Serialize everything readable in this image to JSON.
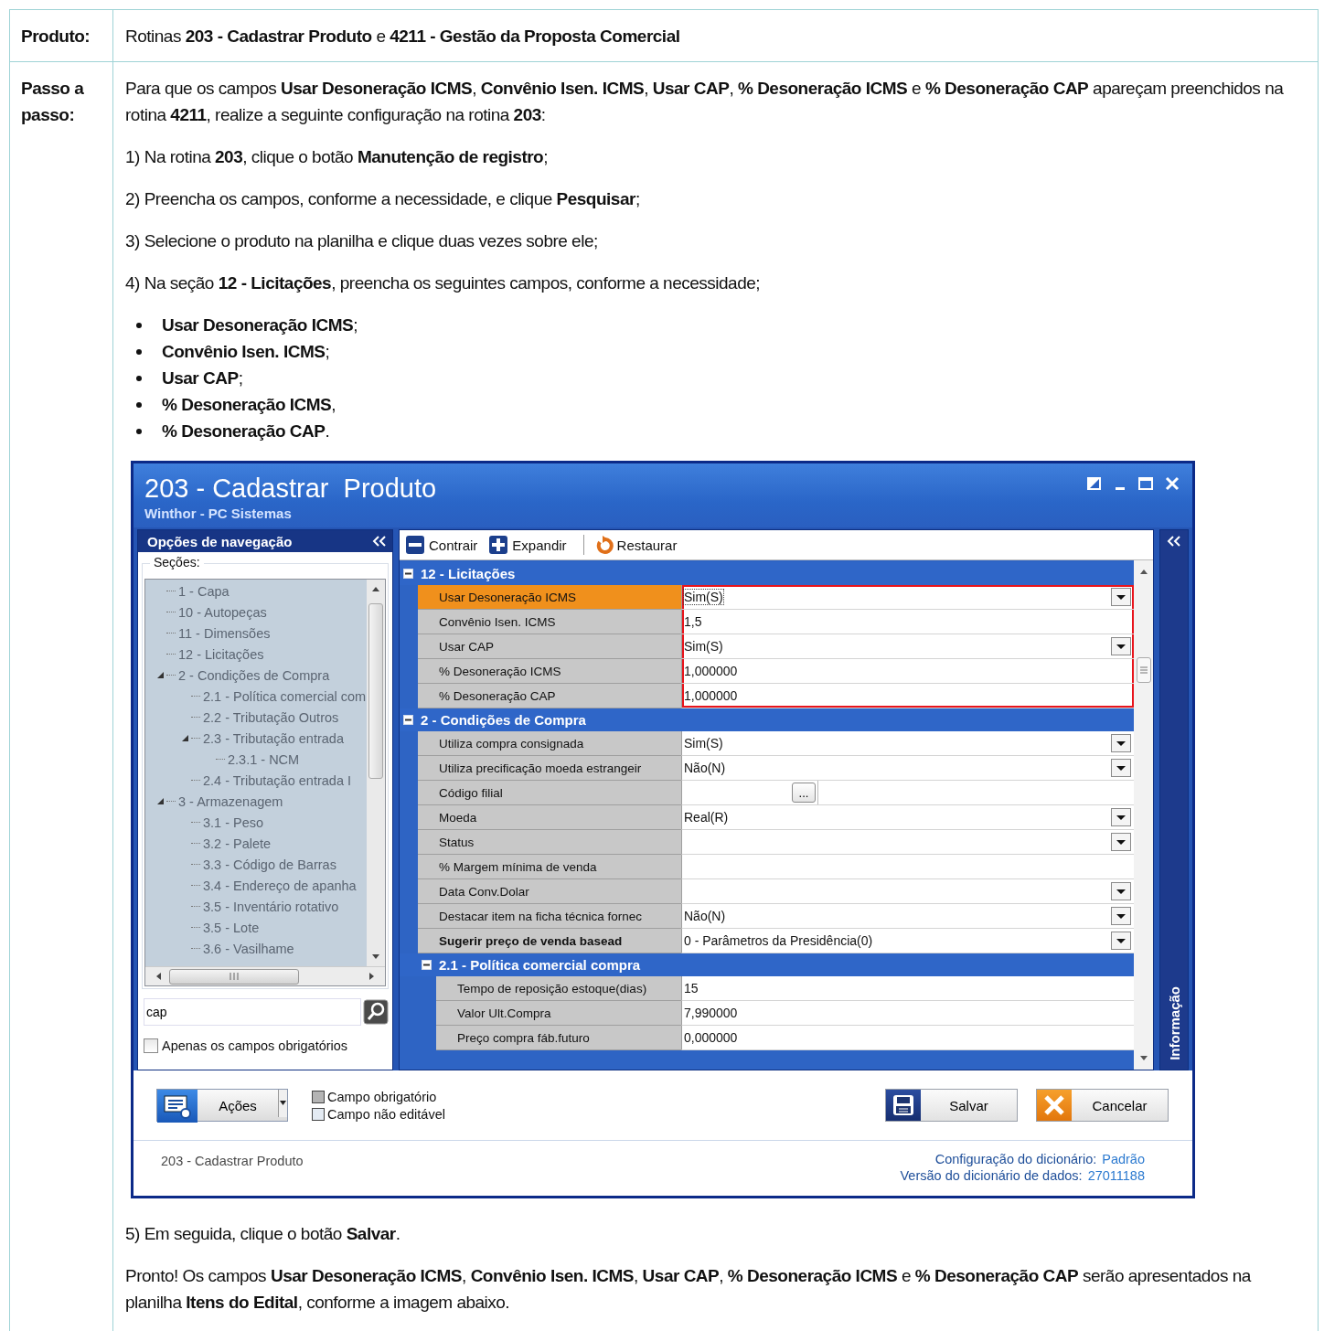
{
  "document": {
    "product_label": "Produto:",
    "product": "Rotinas **203 - Cadastrar Produto** e **4211 - Gestão da Proposta Comercial**",
    "steps_label": "Passo a passo:",
    "intro": "Para que os campos **Usar Desoneração ICMS**, **Convênio Isen. ICMS**, **Usar CAP**, **% Desoneração ICMS** e **% Desoneração CAP** apareçam preenchidos na rotina **4211**, realize a seguinte configuração na rotina **203**:",
    "steps": [
      "1) Na rotina **203**, clique o botão **Manutenção de registro**;",
      "2) Preencha os campos, conforme a necessidade, e clique **Pesquisar**;",
      "3) Selecione o produto na planilha e clique duas vezes sobre ele;",
      "4) Na seção **12 - Licitações**, preencha os seguintes campos, conforme a necessidade;"
    ],
    "bullets": [
      "**Usar Desoneração ICMS**;",
      "**Convênio Isen. ICMS**;",
      "**Usar CAP**;",
      "**% Desoneração ICMS**,",
      "**% Desoneração CAP**."
    ],
    "after": [
      "5) Em seguida, clique o botão **Salvar**.",
      "Pronto! Os campos **Usar Desoneração ICMS**, **Convênio Isen. ICMS**, **Usar CAP**, **% Desoneração ICMS** e **% Desoneração CAP** serão apresentados na planilha **Itens do Edital**, conforme a imagem abaixo."
    ]
  },
  "app": {
    "title": "203 - Cadastrar  Produto",
    "subtitle": "Winthor - PC Sistemas",
    "nav": {
      "title": "Opções de navegação",
      "sections_label": "Seções:",
      "tree": [
        {
          "label": "1 - Capa"
        },
        {
          "label": "10 - Autopeças"
        },
        {
          "label": "11 - Dimensões"
        },
        {
          "label": "12 - Licitações"
        },
        {
          "label": "2 - Condições de Compra",
          "expanded": true,
          "children": [
            {
              "label": "2.1 - Política comercial com"
            },
            {
              "label": "2.2 - Tributação Outros"
            },
            {
              "label": "2.3 - Tributação entrada",
              "expanded": true,
              "children": [
                {
                  "label": "2.3.1 - NCM"
                }
              ]
            },
            {
              "label": "2.4 - Tributação entrada I"
            }
          ]
        },
        {
          "label": "3 - Armazenagem",
          "expanded": true,
          "children": [
            {
              "label": "3.1 - Peso"
            },
            {
              "label": "3.2 - Palete"
            },
            {
              "label": "3.3 - Código de Barras"
            },
            {
              "label": "3.4 - Endereço de apanha"
            },
            {
              "label": "3.5 - Inventário rotativo"
            },
            {
              "label": "3.5 - Lote"
            },
            {
              "label": "3.6 - Vasilhame"
            }
          ]
        }
      ],
      "search": {
        "value": "cap"
      },
      "required_only": {
        "label": "Apenas os campos obrigatórios",
        "checked": false
      }
    },
    "toolbar": [
      {
        "label": "Contrair",
        "kind": "collapse"
      },
      {
        "label": "Expandir",
        "kind": "expand"
      },
      {
        "label": "Restaurar",
        "kind": "restore"
      }
    ],
    "grid": {
      "sections": [
        {
          "title": "12 - Licitações",
          "expanded": true,
          "rows": [
            {
              "label": "Usar Desoneração ICMS",
              "value": "Sim(S)",
              "kind": "combo",
              "selected": true,
              "outlined": true,
              "required": false
            },
            {
              "label": "Convênio Isen. ICMS",
              "value": "1,5",
              "kind": "text",
              "selected": false,
              "outlined": true,
              "required": false
            },
            {
              "label": "Usar CAP",
              "value": "Sim(S)",
              "kind": "combo",
              "selected": false,
              "outlined": true,
              "required": false
            },
            {
              "label": "% Desoneração ICMS",
              "value": "1,000000",
              "kind": "text",
              "selected": false,
              "outlined": true,
              "required": false
            },
            {
              "label": "% Desoneração CAP",
              "value": "1,000000",
              "kind": "text",
              "selected": false,
              "outlined": true,
              "required": false
            }
          ]
        },
        {
          "title": "2 - Condições de Compra",
          "expanded": true,
          "rows": [
            {
              "label": "Utiliza compra consignada",
              "value": "Sim(S)",
              "kind": "combo",
              "selected": false,
              "outlined": false,
              "required": false
            },
            {
              "label": "Utiliza precificação moeda estrangeir",
              "value": "Não(N)",
              "kind": "combo",
              "selected": false,
              "outlined": false,
              "required": false
            },
            {
              "label": "Código filial",
              "kind": "lookup",
              "button": "...",
              "selected": false,
              "outlined": false,
              "required": false
            },
            {
              "label": "Moeda",
              "value": "Real(R)",
              "kind": "combo",
              "selected": false,
              "outlined": false,
              "required": false
            },
            {
              "label": "Status",
              "kind": "combo",
              "selected": false,
              "outlined": false,
              "required": false
            },
            {
              "label": "% Margem mínima de venda",
              "kind": "text",
              "selected": false,
              "outlined": false,
              "required": false
            },
            {
              "label": "Data Conv.Dolar",
              "kind": "combo",
              "selected": false,
              "outlined": false,
              "required": false
            },
            {
              "label": "Destacar item na ficha técnica fornec",
              "value": "Não(N)",
              "kind": "combo",
              "selected": false,
              "outlined": false,
              "required": false
            },
            {
              "label": "Sugerir preço de venda basead",
              "value": "0 - Parâmetros da Presidência(0)",
              "kind": "combo",
              "selected": false,
              "outlined": false,
              "required": true
            }
          ],
          "children": [
            {
              "title": "2.1 - Política comercial compra",
              "expanded": true,
              "rows": [
                {
                  "label": "Tempo de reposição estoque(dias)",
                  "value": "15",
                  "kind": "text",
                  "selected": false,
                  "outlined": false,
                  "required": false
                },
                {
                  "label": "Valor Ult.Compra",
                  "value": "7,990000",
                  "kind": "text",
                  "selected": false,
                  "outlined": false,
                  "required": false
                },
                {
                  "label": "Preço compra fáb.futuro",
                  "value": "0,000000",
                  "kind": "text",
                  "selected": false,
                  "outlined": false,
                  "required": false
                }
              ]
            }
          ]
        }
      ]
    },
    "side_tab": "Informação",
    "actions_button": "Ações",
    "legend": [
      {
        "label": "Campo obrigatório",
        "color": "#b4b4b4"
      },
      {
        "label": "Campo não editável",
        "color": "#e4ebf3"
      }
    ],
    "buttons": [
      {
        "label": "Salvar",
        "kind": "save"
      },
      {
        "label": "Cancelar",
        "kind": "cancel"
      }
    ],
    "status": {
      "left": "203 - Cadastrar  Produto",
      "config_label": "Configuração do dicionário:",
      "config_value": "Padrão",
      "version_label": "Versão do dicionário de dados:",
      "version_value": "27011188"
    }
  }
}
